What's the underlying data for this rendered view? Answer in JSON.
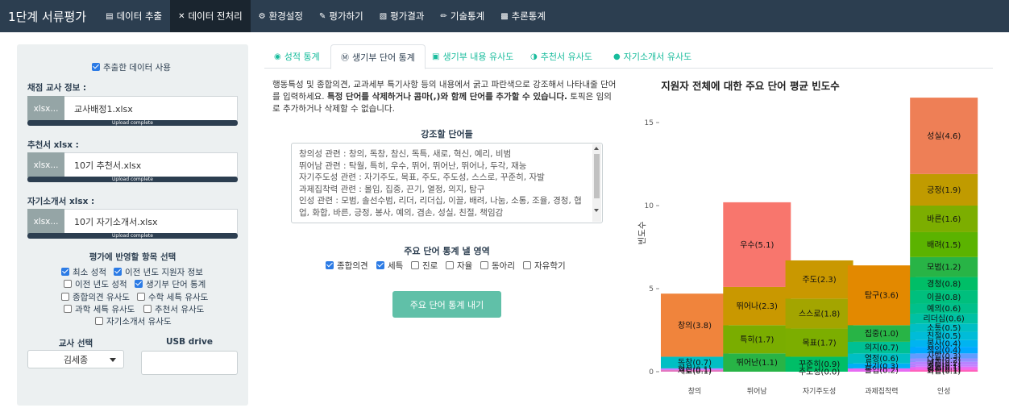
{
  "navbar": {
    "brand": "1단계 서류평가",
    "items": [
      {
        "label": "데이터 추출",
        "icon": "database-icon",
        "active": false
      },
      {
        "label": "데이터 전처리",
        "icon": "tools-icon",
        "active": true
      },
      {
        "label": "환경설정",
        "icon": "gears-icon",
        "active": false
      },
      {
        "label": "평가하기",
        "icon": "edit-doc-icon",
        "active": false
      },
      {
        "label": "평가결과",
        "icon": "file-icon",
        "active": false
      },
      {
        "label": "기술통계",
        "icon": "pencil-icon",
        "active": false
      },
      {
        "label": "추론통계",
        "icon": "bar-chart-icon",
        "active": false
      }
    ]
  },
  "sidebar": {
    "use_extracted_label": "추출한 데이터 사용",
    "teacher_info_label": "채점 교사 정보 :",
    "teacher_file_btn": "xlsx...",
    "teacher_file_name": "교사배정1.xlsx",
    "upload_complete": "Upload complete",
    "rec_label": "추천서 xlsx :",
    "rec_file_btn": "xlsx...",
    "rec_file_name": "10기 추천서.xlsx",
    "self_label": "자기소개서 xlsx :",
    "self_file_btn": "xlsx...",
    "self_file_name": "10기 자기소개서.xlsx",
    "items_title": "평가에 반영할 항목 선택",
    "options": [
      {
        "label": "최소 성적",
        "checked": true
      },
      {
        "label": "이전 년도 지원자 정보",
        "checked": true
      },
      {
        "label": "이전 년도 성적",
        "checked": false
      },
      {
        "label": "생기부 단어 통계",
        "checked": true
      },
      {
        "label": "종합의견 유사도",
        "checked": false
      },
      {
        "label": "수학 세특 유사도",
        "checked": false
      },
      {
        "label": "과학 세특 유사도",
        "checked": false
      },
      {
        "label": "추천서 유사도",
        "checked": false
      },
      {
        "label": "자기소개서 유사도",
        "checked": false
      }
    ],
    "teacher_select_label": "교사 선택",
    "teacher_selected": "김세종",
    "usb_label": "USB drive"
  },
  "tabs": [
    {
      "label": "성적 통계",
      "icon": "money-icon",
      "active": false
    },
    {
      "label": "생기부 단어 통계",
      "icon": "wordpress-icon",
      "active": true
    },
    {
      "label": "생기부 내용 유사도",
      "icon": "save-icon",
      "active": false
    },
    {
      "label": "추천서 유사도",
      "icon": "glasses-icon",
      "active": false
    },
    {
      "label": "자기소개서 유사도",
      "icon": "dollar-icon",
      "active": false
    }
  ],
  "main": {
    "desc_part1": "행동특성 및 종합의견, 교과세부 특기사항 등의 내용에서 굵고 파란색으로 강조해서 나타내줄 단어를 입력하세요. ",
    "desc_bold": "특정 단어를 삭제하거나 콤마(,)와 함께 단어를 추가할 수 있습니다.",
    "desc_part2": " 토픽은 임의로 추가하거나 삭제할 수 없습니다.",
    "emphasis_title": "강조할 단어들",
    "emphasis_lines": [
      "창의성 관련 : 창의, 독창, 참신, 독특, 새로, 혁신, 예리, 비범",
      "뛰어남 관련 : 탁월, 특히, 우수, 뛰어, 뛰어난, 뛰어나, 두각, 재능",
      "자기주도성 관련 : 자기주도, 목표, 주도, 주도성, 스스로, 꾸준히, 자발",
      "과제집착력 관련 : 몰입, 집중, 끈기, 열정, 의지, 탐구",
      "인성 관련 : 모범, 솔선수범, 리더, 리더십, 이끌, 배려, 나눔, 소통, 조율, 경청, 협업, 화합, 바른, 긍정, 봉사, 예의, 겸손, 성실, 친절, 책임감"
    ],
    "area_title": "주요 단어 통계 낼 영역",
    "areas": [
      {
        "label": "종합의견",
        "checked": true
      },
      {
        "label": "세특",
        "checked": true
      },
      {
        "label": "진로",
        "checked": false
      },
      {
        "label": "자율",
        "checked": false
      },
      {
        "label": "동아리",
        "checked": false
      },
      {
        "label": "자유학기",
        "checked": false
      }
    ],
    "stats_button": "주요 단어 통계 내기"
  },
  "chart_data": {
    "type": "bar",
    "stacked": true,
    "title": "지원자 전체에 대한 주요 단어 평균 빈도수",
    "ylabel": "빈도수",
    "xlabel": "",
    "ylim": [
      0,
      17
    ],
    "yticks": [
      0,
      5,
      10,
      15
    ],
    "categories": [
      "창의",
      "뛰어남",
      "자기주도성",
      "과제집착력",
      "인성"
    ],
    "stacks": [
      [
        {
          "label": "새로",
          "value": 0.1,
          "color": "#e377c2"
        },
        {
          "label": "혁신",
          "value": 0.1,
          "color": "#c77cff"
        },
        {
          "label": "독창",
          "value": 0.7,
          "color": "#00bfc4"
        },
        {
          "label": "창의",
          "value": 3.8,
          "color": "#f0843c"
        }
      ],
      [
        {
          "label": "뛰어난",
          "value": 1.1,
          "color": "#28b446"
        },
        {
          "label": "특히",
          "value": 1.7,
          "color": "#7aad00"
        },
        {
          "label": "뛰어나",
          "value": 2.3,
          "color": "#c99800"
        },
        {
          "label": "우수",
          "value": 5.1,
          "color": "#f8766d"
        }
      ],
      [
        {
          "label": "주도성",
          "value": 0.0,
          "color": "#00b0f6"
        },
        {
          "label": "꾸준히",
          "value": 0.9,
          "color": "#00be67"
        },
        {
          "label": "목표",
          "value": 1.7,
          "color": "#7cae00"
        },
        {
          "label": "스스로",
          "value": 1.8,
          "color": "#a3a500"
        },
        {
          "label": "주도",
          "value": 2.3,
          "color": "#c99800"
        }
      ],
      [
        {
          "label": "몰입",
          "value": 0.2,
          "color": "#e76bf3"
        },
        {
          "label": "끈기",
          "value": 0.3,
          "color": "#00b0f6"
        },
        {
          "label": "열정",
          "value": 0.6,
          "color": "#00bfc4"
        },
        {
          "label": "의지",
          "value": 0.7,
          "color": "#00c094"
        },
        {
          "label": "집중",
          "value": 1.0,
          "color": "#28b446"
        },
        {
          "label": "탐구",
          "value": 3.6,
          "color": "#e38900"
        }
      ],
      [
        {
          "label": "화합",
          "value": 0.1,
          "color": "#ff62bc"
        },
        {
          "label": "겸손",
          "value": 0.1,
          "color": "#f564e3"
        },
        {
          "label": "협업",
          "value": 0.1,
          "color": "#e76bf3"
        },
        {
          "label": "조율",
          "value": 0.1,
          "color": "#c77cff"
        },
        {
          "label": "예리",
          "value": 0.2,
          "color": "#b983ff"
        },
        {
          "label": "나눔",
          "value": 0.2,
          "color": "#9590ff"
        },
        {
          "label": "자발",
          "value": 0.3,
          "color": "#619cff"
        },
        {
          "label": "책임",
          "value": 0.4,
          "color": "#00a9ff"
        },
        {
          "label": "봉사",
          "value": 0.4,
          "color": "#00b4f0"
        },
        {
          "label": "친절",
          "value": 0.5,
          "color": "#00bcd8"
        },
        {
          "label": "소통",
          "value": 0.5,
          "color": "#00bfc4"
        },
        {
          "label": "리더십",
          "value": 0.6,
          "color": "#00c1a3"
        },
        {
          "label": "예의",
          "value": 0.6,
          "color": "#00c08b"
        },
        {
          "label": "이끌",
          "value": 0.8,
          "color": "#00bf7d"
        },
        {
          "label": "경청",
          "value": 0.8,
          "color": "#00be67"
        },
        {
          "label": "모범",
          "value": 1.2,
          "color": "#28b446"
        },
        {
          "label": "배려",
          "value": 1.5,
          "color": "#5bb300"
        },
        {
          "label": "바른",
          "value": 1.6,
          "color": "#7cae00"
        },
        {
          "label": "긍정",
          "value": 1.9,
          "color": "#c09b00"
        },
        {
          "label": "성실",
          "value": 4.6,
          "color": "#ee7f56"
        }
      ]
    ]
  }
}
